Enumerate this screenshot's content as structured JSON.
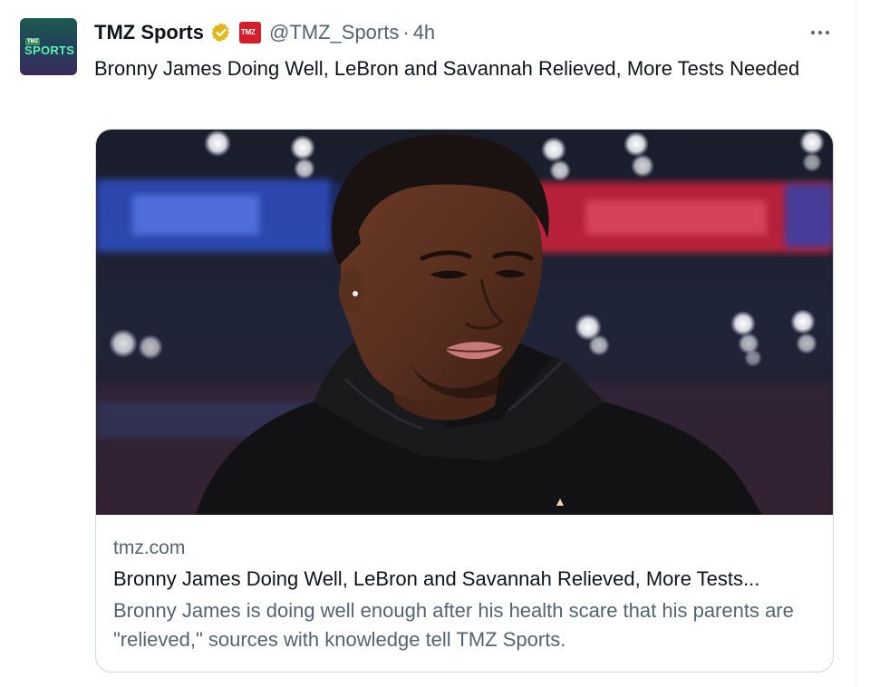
{
  "account": {
    "display_name": "TMZ Sports",
    "handle": "@TMZ_Sports",
    "separator": "·",
    "time_ago": "4h",
    "avatar_text_top": "TMZ",
    "avatar_text_main": "SPORTS",
    "affiliate_badge_text": "TMZ",
    "verified_icon": "gold-verified-badge",
    "brand_color": "#d21f2b"
  },
  "tweet": {
    "text": "Bronny James Doing Well, LeBron and Savannah Relieved, More Tests Needed"
  },
  "card": {
    "domain": "tmz.com",
    "title": "Bronny James Doing Well, LeBron and Savannah Relieved, More Tests...",
    "description": "Bronny James is doing well enough after his health scare that his parents are \"relieved,\" sources with knowledge tell TMZ Sports.",
    "image_alt": "Bronny James in a black hoodie inside an arena"
  },
  "icons": {
    "more": "more-horizontal-icon"
  }
}
